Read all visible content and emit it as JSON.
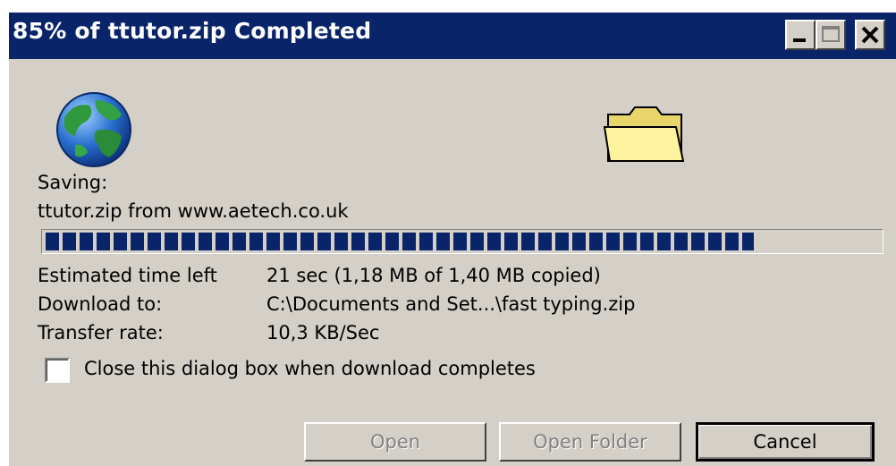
{
  "window": {
    "title": "85% of ttutor.zip Completed",
    "titlebar_color": "#0a246a",
    "face_color": "#d4d0c8"
  },
  "title_buttons": [
    {
      "name": "minimize",
      "icon": "minimize-icon"
    },
    {
      "name": "maximize",
      "icon": "maximize-icon"
    },
    {
      "name": "close",
      "icon": "close-icon"
    }
  ],
  "icons": {
    "source": "globe-icon",
    "destination": "folder-icon"
  },
  "status": {
    "saving_label": "Saving:",
    "file_source": "ttutor.zip from www.aetech.co.uk"
  },
  "progress": {
    "percent": 85,
    "color": "#0a246a"
  },
  "details": {
    "estimated_label": "Estimated time left",
    "estimated_value": "21 sec (1,18 MB of 1,40 MB copied)",
    "download_to_label": "Download to:",
    "download_to_value": "C:\\Documents and Set...\\fast typing.zip",
    "rate_label": "Transfer rate:",
    "rate_value": "10,3 KB/Sec"
  },
  "close_when_done": {
    "label": "Close this dialog box when download completes",
    "checked": false
  },
  "buttons": {
    "open": "Open",
    "open_folder": "Open Folder",
    "cancel": "Cancel"
  }
}
